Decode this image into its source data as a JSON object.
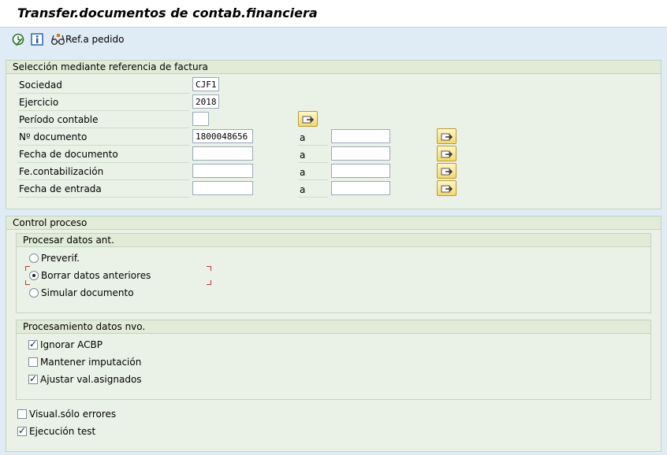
{
  "window": {
    "title": "Transfer.documentos de contab.financiera"
  },
  "toolbar": {
    "execute_icon": "execute-clock-icon",
    "info_icon": "info-icon",
    "ref_icon": "glasses-icon",
    "ref_label": "Ref.a pedido"
  },
  "selection": {
    "header": "Selección mediante referencia de factura",
    "to_label": "a",
    "fields": {
      "sociedad": {
        "label": "Sociedad",
        "value": "CJF1"
      },
      "ejercicio": {
        "label": "Ejercicio",
        "value": "2018"
      },
      "periodo": {
        "label": "Período contable",
        "value": ""
      },
      "documento": {
        "label": "Nº documento",
        "from": "1800048656",
        "to": ""
      },
      "fecha_doc": {
        "label": "Fecha de documento",
        "from": "",
        "to": ""
      },
      "fe_contab": {
        "label": "Fe.contabilización",
        "from": "",
        "to": ""
      },
      "fecha_entrada": {
        "label": "Fecha de entrada",
        "from": "",
        "to": ""
      }
    }
  },
  "control": {
    "header": "Control proceso",
    "prev_data": {
      "header": "Procesar datos ant.",
      "options": {
        "preverif": {
          "label": "Preverif.",
          "selected": false
        },
        "borrar": {
          "label": "Borrar datos anteriores",
          "selected": true
        },
        "simular": {
          "label": "Simular documento",
          "selected": false
        }
      }
    },
    "new_data": {
      "header": "Procesamiento datos nvo.",
      "ignorar": {
        "label": "Ignorar ACBP",
        "checked": true
      },
      "mantener": {
        "label": "Mantener imputación",
        "checked": false
      },
      "ajustar": {
        "label": "Ajustar val.asignados",
        "checked": true
      }
    },
    "visual": {
      "label": "Visual.sólo errores",
      "checked": false
    },
    "ejecucion": {
      "label": "Ejecución test",
      "checked": true
    }
  }
}
